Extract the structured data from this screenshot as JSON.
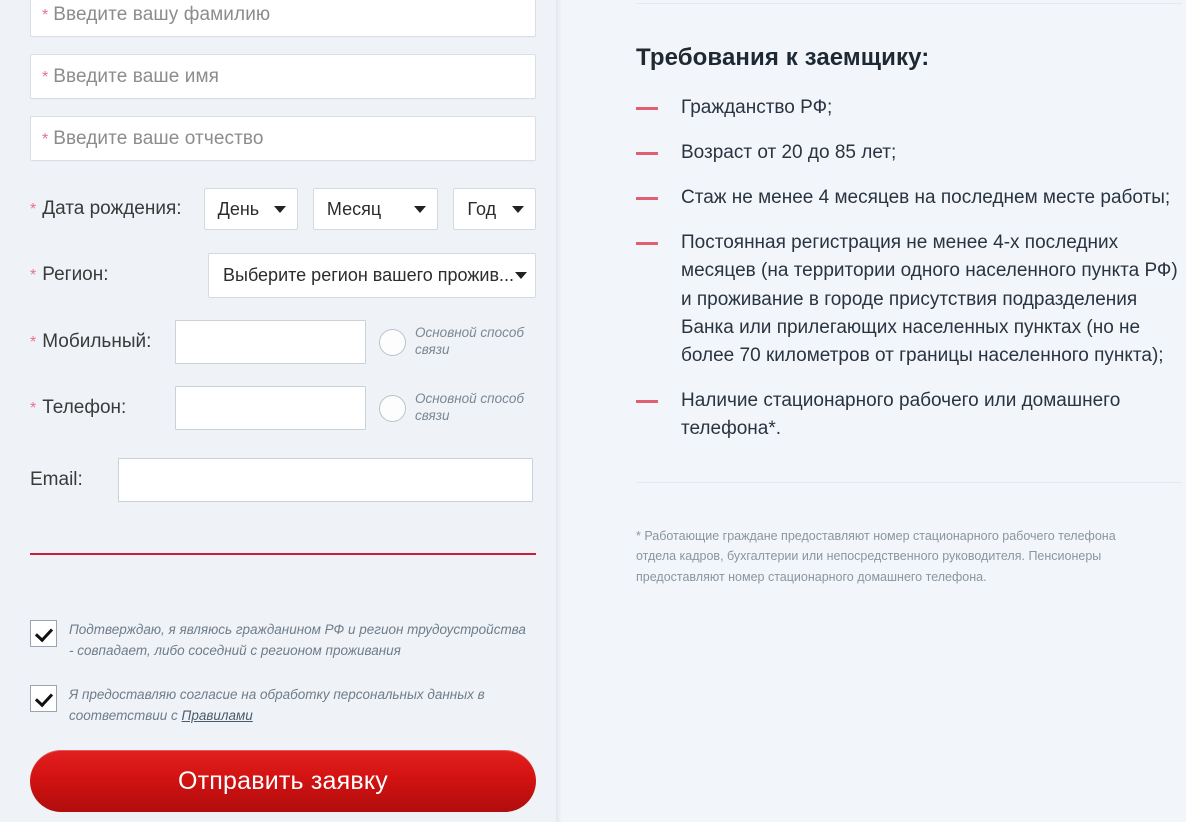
{
  "form": {
    "name_fields": [
      {
        "name": "surname",
        "required_mark": "*",
        "placeholder": "Введите вашу фамилию"
      },
      {
        "name": "firstname",
        "required_mark": "*",
        "placeholder": "Введите ваше имя"
      },
      {
        "name": "patronymic",
        "required_mark": "*",
        "placeholder": "Введите ваше отчество"
      }
    ],
    "birthdate": {
      "required_mark": "*",
      "label": "Дата рождения:",
      "day": "День",
      "month": "Месяц",
      "year": "Год"
    },
    "region": {
      "required_mark": "*",
      "label": "Регион:",
      "value": "Выберите регион вашего прожив..."
    },
    "mobile": {
      "required_mark": "*",
      "label": "Мобильный:",
      "value": "",
      "radio_label": "Основной способ связи"
    },
    "phone": {
      "required_mark": "*",
      "label": "Телефон:",
      "value": "",
      "radio_label": "Основной способ связи"
    },
    "email": {
      "label": "Email:",
      "value": ""
    },
    "consents": [
      {
        "checked": true,
        "text": "Подтверждаю, я являюсь гражданином РФ и регион трудоустройства - совпадает, либо соседний с регионом проживания"
      },
      {
        "checked": true,
        "text_before": "Я предоставляю согласие на обработку персональных данных в соответствии с ",
        "link_text": "Правилами"
      }
    ],
    "submit_label": "Отправить заявку"
  },
  "requirements": {
    "title": "Требования к заемщику:",
    "items": [
      "Гражданство РФ;",
      "Возраст от 20 до 85 лет;",
      "Стаж не менее 4 месяцев на последнем месте работы;",
      "Постоянная регистрация не менее 4-х последних месяцев (на территории одного населенного пункта РФ) и проживание в городе присутствия подразделения Банка или прилегающих населенных пунктах (но не более 70 километров от границы населенного пункта);",
      "Наличие стационарного рабочего или домашнего телефона*."
    ],
    "footnote": "* Работающие граждане предоставляют номер стационарного рабочего телефона отдела кадров, бухгалтерии или непосредственного руководителя. Пенсионеры предоставляют номер стационарного домашнего телефона."
  },
  "colors": {
    "accent_red": "#c8203c",
    "button_red": "#d31212",
    "dash_red": "#e0606f",
    "required_star": "#e8728a",
    "background": "#f1f5f9"
  }
}
